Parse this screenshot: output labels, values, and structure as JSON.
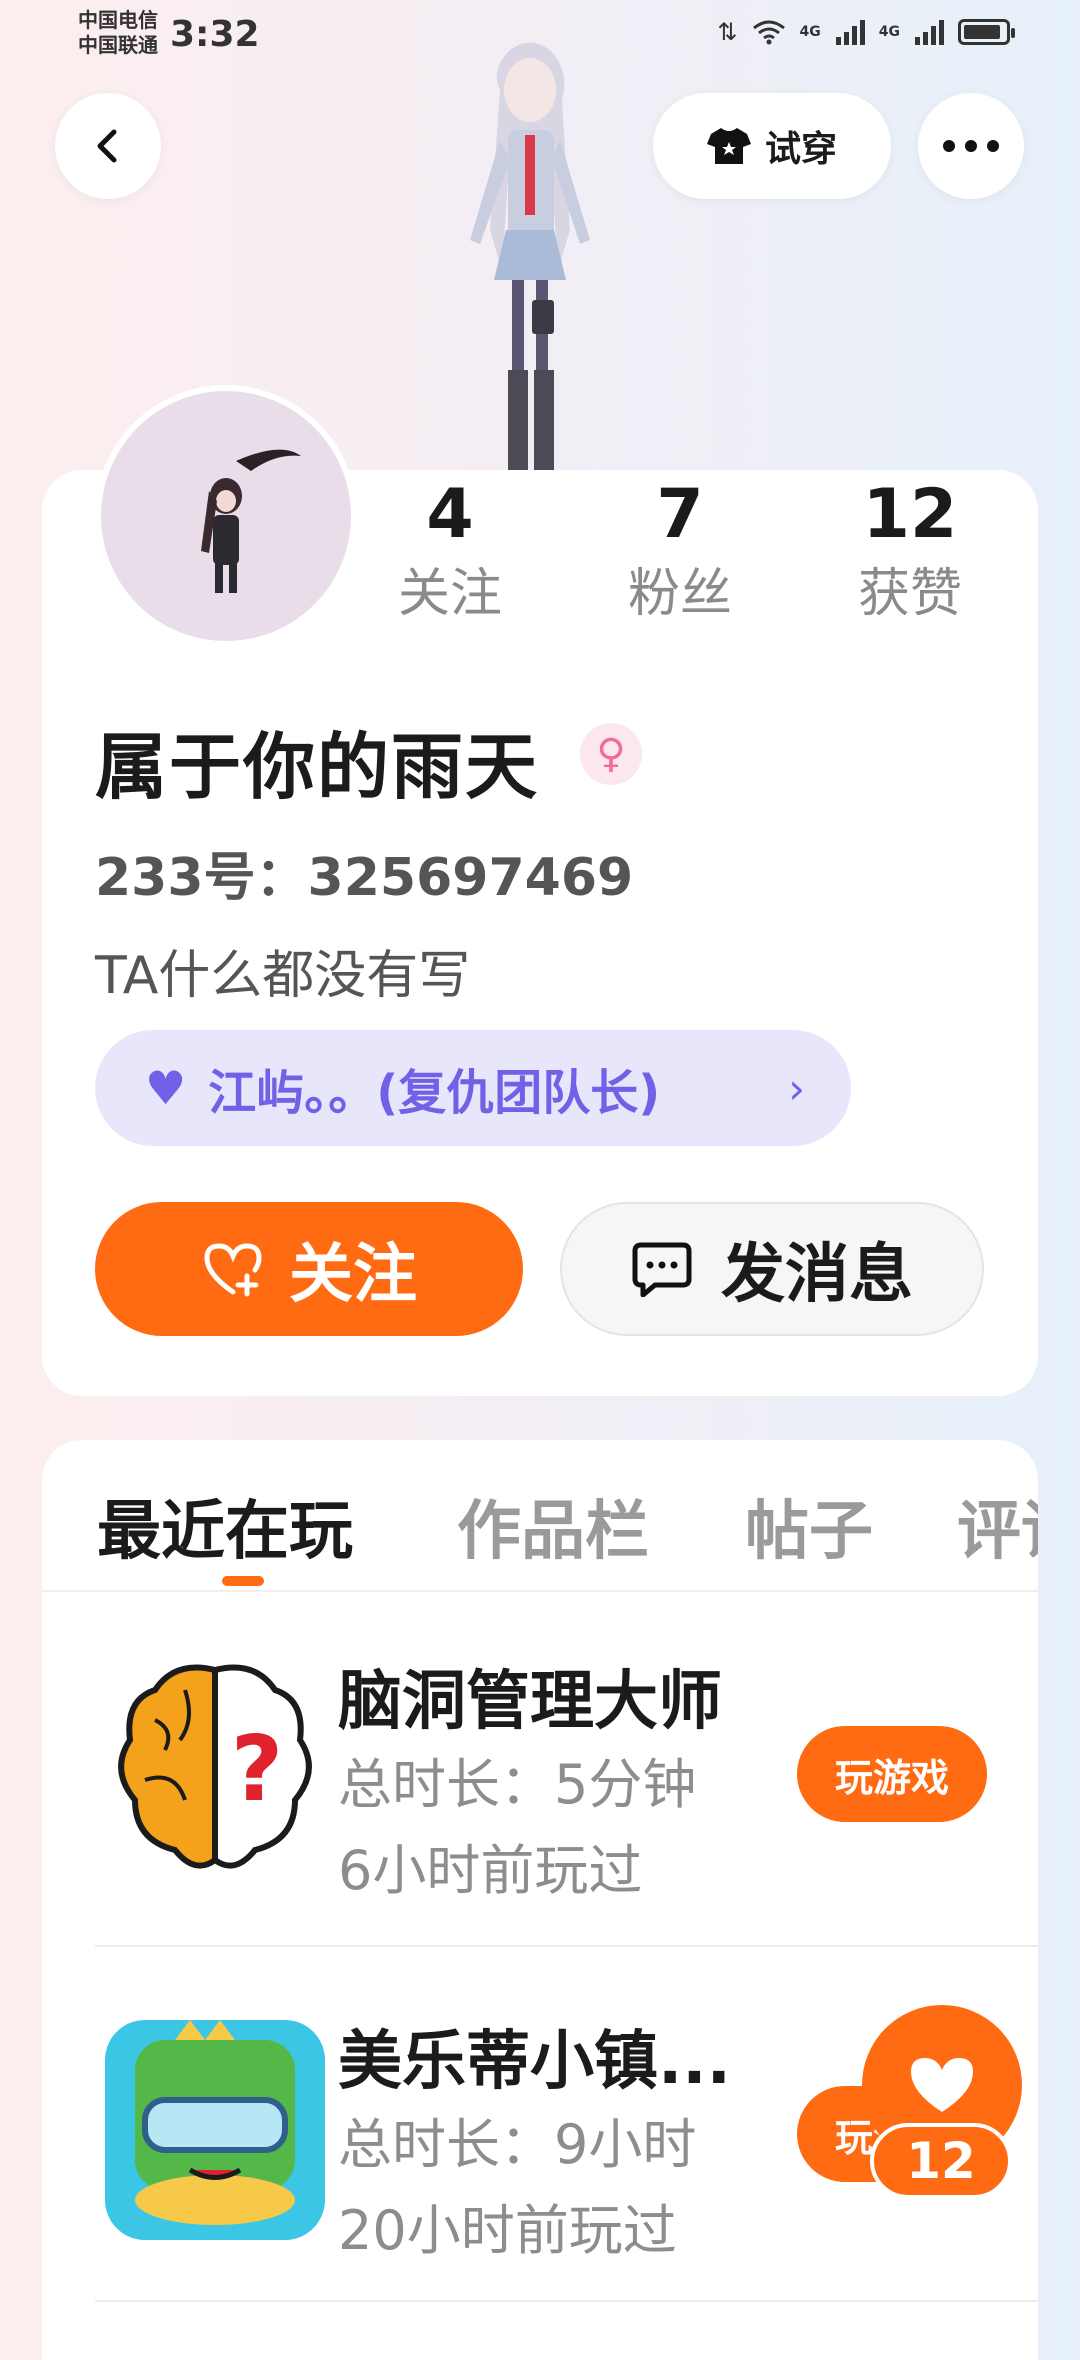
{
  "status_bar": {
    "carrier_1": "中国电信",
    "carrier_2": "中国联通",
    "time": "3:32",
    "network_1": "4G",
    "network_2": "4G",
    "battery_level": 0.8
  },
  "header": {
    "try_on_label": "试穿"
  },
  "profile": {
    "stats": [
      {
        "value": "4",
        "label": "关注"
      },
      {
        "value": "7",
        "label": "粉丝"
      },
      {
        "value": "12",
        "label": "获赞"
      }
    ],
    "username": "属于你的雨天",
    "gender_symbol": "♀",
    "user_id": "233号：325697469",
    "bio": "TA什么都没有写",
    "team_label": "江屿。。(复仇团队长)",
    "follow_label": "关注",
    "message_label": "发消息"
  },
  "tabs": [
    "最近在玩",
    "作品栏",
    "帖子",
    "评论"
  ],
  "games": [
    {
      "name": "脑洞管理大师",
      "total_time": "总时长：5分钟",
      "last_played": "6小时前玩过",
      "action": "玩游戏"
    },
    {
      "name": "美乐蒂小镇...",
      "total_time": "总时长：9小时",
      "last_played": "20小时前玩过",
      "action": "玩游戏"
    }
  ],
  "like_fab": {
    "count": "12"
  },
  "colors": {
    "accent": "#ff6b12",
    "team_purple": "#7261e6",
    "team_bg": "#e8e6fb"
  }
}
